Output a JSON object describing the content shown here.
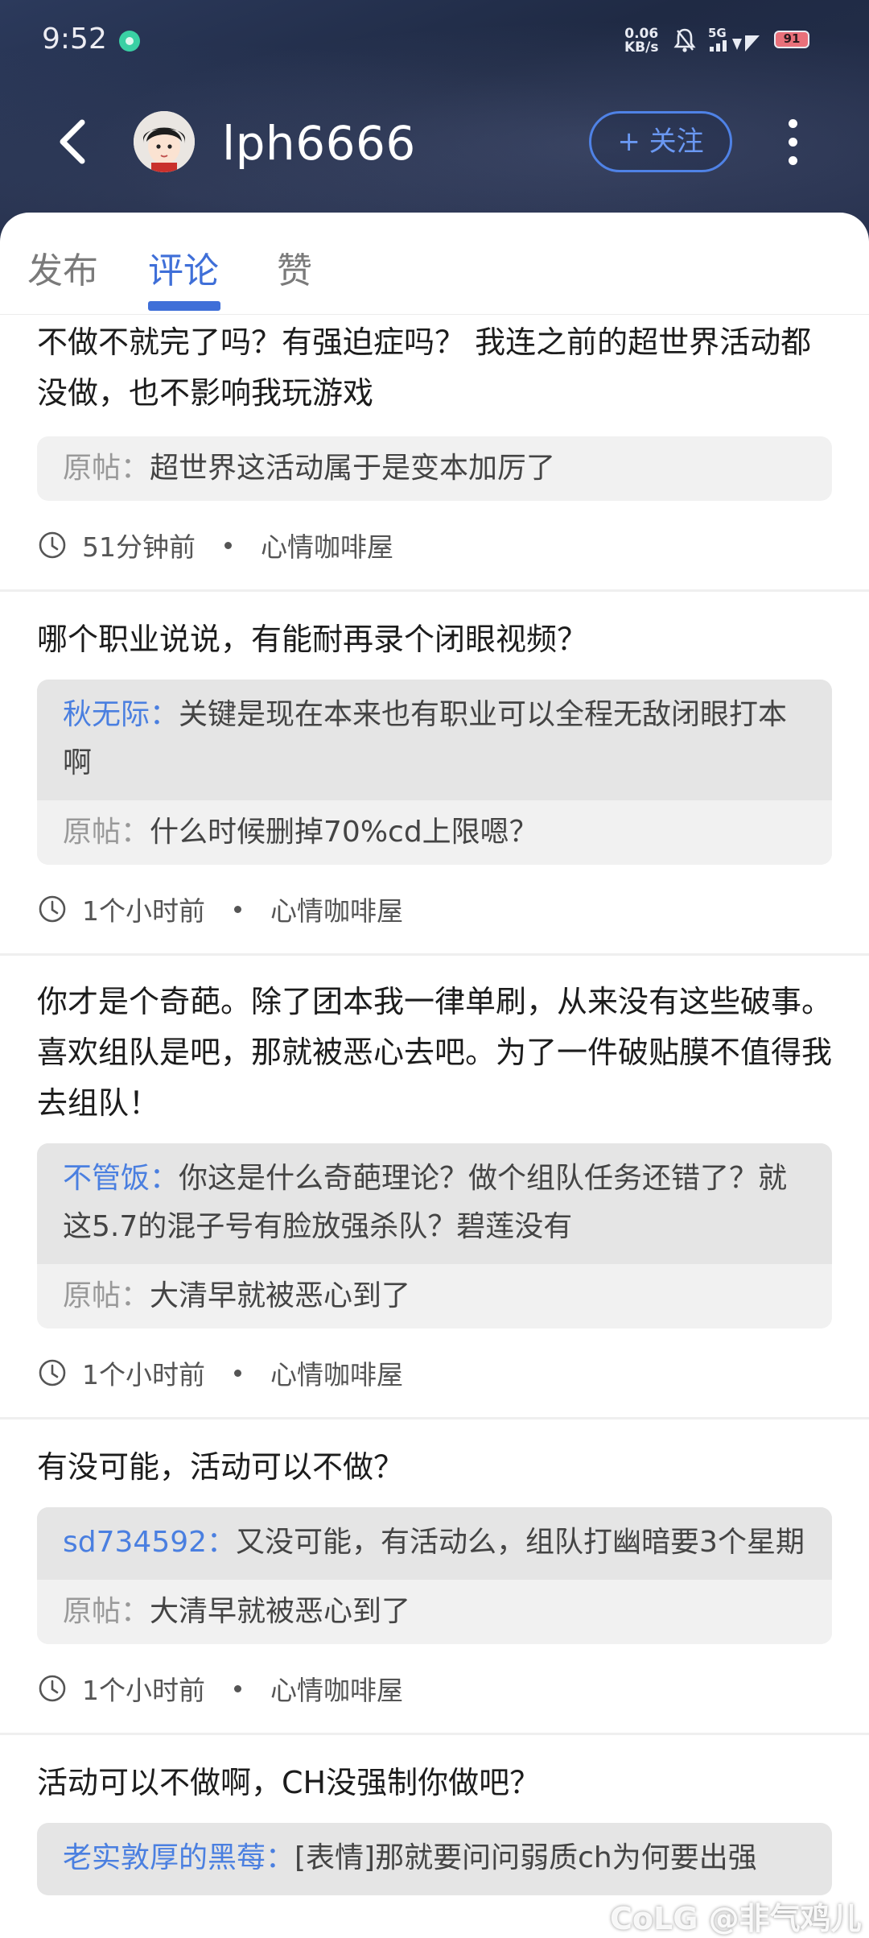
{
  "status_bar": {
    "time": "9:52",
    "net_speed_value": "0.06",
    "net_speed_unit": "KB/s",
    "signal_label": "5G",
    "battery": "91"
  },
  "header": {
    "username": "lph6666",
    "follow_label": "+ 关注"
  },
  "tabs": [
    {
      "label": "发布",
      "active": false
    },
    {
      "label": "评论",
      "active": true
    },
    {
      "label": "赞",
      "active": false
    }
  ],
  "items": [
    {
      "text": "不做不就完了吗？有强迫症吗？ 我连之前的超世界活动都没做，也不影响我玩游戏",
      "original_label": "原帖：",
      "original": "超世界这活动属于是变本加厉了",
      "time": "51分钟前",
      "forum": "心情咖啡屋"
    },
    {
      "text": "哪个职业说说，有能耐再录个闭眼视频？",
      "reply_name": "秋无际：",
      "reply_text": "关键是现在本来也有职业可以全程无敌闭眼打本啊",
      "original_label": "原帖：",
      "original": "什么时候删掉70%cd上限嗯？",
      "time": "1个小时前",
      "forum": "心情咖啡屋"
    },
    {
      "text": "你才是个奇葩。除了团本我一律单刷，从来没有这些破事。喜欢组队是吧，那就被恶心去吧。为了一件破贴膜不值得我去组队！",
      "reply_name": "不管饭：",
      "reply_text": "你这是什么奇葩理论？做个组队任务还错了？就这5.7的混子号有脸放强杀队？碧莲没有",
      "original_label": "原帖：",
      "original": "大清早就被恶心到了",
      "time": "1个小时前",
      "forum": "心情咖啡屋"
    },
    {
      "text": "有没可能，活动可以不做？",
      "reply_name": "sd734592：",
      "reply_text": "又没可能，有活动么，组队打幽暗要3个星期",
      "original_label": "原帖：",
      "original": "大清早就被恶心到了",
      "time": "1个小时前",
      "forum": "心情咖啡屋"
    },
    {
      "text": "活动可以不做啊，CH没强制你做吧？",
      "reply_name": "老实敦厚的黑莓：",
      "reply_text": "[表情]那就要问问弱质ch为何要出强"
    }
  ],
  "watermark": "CoLG @非气鸡儿",
  "colors": {
    "accent": "#3f6fd8",
    "reply_name": "#4a7fe0",
    "header_bg": "#222d48"
  },
  "icons": {
    "back": "back-arrow-icon",
    "more": "more-vertical-icon",
    "clock": "clock-icon",
    "notification": "bell-icon"
  }
}
